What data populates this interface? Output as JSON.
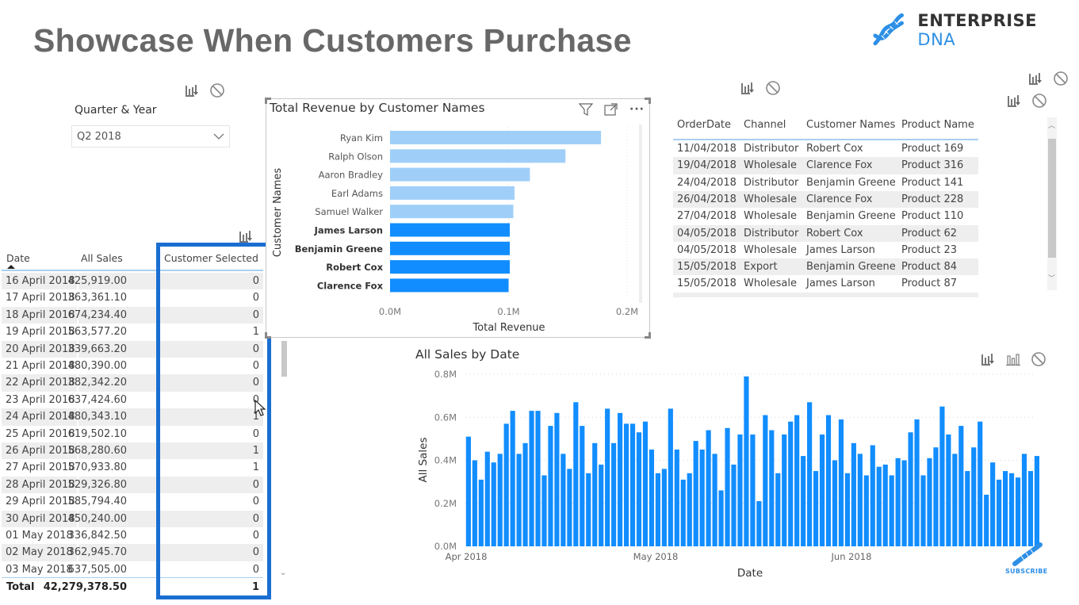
{
  "page": {
    "title": "Showcase When Customers Purchase",
    "logo_text_main": "ENTERPRISE",
    "logo_text_accent": "DNA",
    "subscribe_label": "SUBSCRIBE",
    "accent_color": "#2d8fe6"
  },
  "slicer": {
    "label": "Quarter & Year",
    "selected_value": "Q2 2018"
  },
  "sales_table": {
    "columns": [
      "Date",
      "All Sales",
      "Customer Selected"
    ],
    "rows": [
      {
        "date": "16 April 2018",
        "sales": "425,919.00",
        "selected": "0"
      },
      {
        "date": "17 April 2018",
        "sales": "363,361.10",
        "selected": "0"
      },
      {
        "date": "18 April 2018",
        "sales": "674,234.40",
        "selected": "0"
      },
      {
        "date": "19 April 2018",
        "sales": "563,577.20",
        "selected": "1"
      },
      {
        "date": "20 April 2018",
        "sales": "339,663.20",
        "selected": "0"
      },
      {
        "date": "21 April 2018",
        "sales": "480,390.00",
        "selected": "0"
      },
      {
        "date": "22 April 2018",
        "sales": "382,342.20",
        "selected": "0"
      },
      {
        "date": "23 April 2018",
        "sales": "637,424.60",
        "selected": "0"
      },
      {
        "date": "24 April 2018",
        "sales": "480,343.10",
        "selected": "1"
      },
      {
        "date": "25 April 2018",
        "sales": "619,502.10",
        "selected": "0"
      },
      {
        "date": "26 April 2018",
        "sales": "568,280.60",
        "selected": "1"
      },
      {
        "date": "27 April 2018",
        "sales": "570,933.80",
        "selected": "1"
      },
      {
        "date": "28 April 2018",
        "sales": "529,326.80",
        "selected": "0"
      },
      {
        "date": "29 April 2018",
        "sales": "585,794.40",
        "selected": "0"
      },
      {
        "date": "30 April 2018",
        "sales": "450,240.00",
        "selected": "0"
      },
      {
        "date": "01 May 2018",
        "sales": "336,842.50",
        "selected": "0"
      },
      {
        "date": "02 May 2018",
        "sales": "362,945.70",
        "selected": "0"
      },
      {
        "date": "03 May 2018",
        "sales": "637,505.00",
        "selected": "0"
      }
    ],
    "total": {
      "label": "Total",
      "sales": "42,279,378.50",
      "selected": "1"
    }
  },
  "orders_table": {
    "columns": [
      "OrderDate",
      "Channel",
      "Customer Names",
      "Product Name"
    ],
    "rows": [
      [
        "11/04/2018",
        "Distributor",
        "Robert Cox",
        "Product 169"
      ],
      [
        "19/04/2018",
        "Wholesale",
        "Clarence Fox",
        "Product 316"
      ],
      [
        "24/04/2018",
        "Distributor",
        "Benjamin Greene",
        "Product 141"
      ],
      [
        "26/04/2018",
        "Wholesale",
        "Clarence Fox",
        "Product 228"
      ],
      [
        "27/04/2018",
        "Wholesale",
        "Benjamin Greene",
        "Product 110"
      ],
      [
        "04/05/2018",
        "Distributor",
        "Robert Cox",
        "Product 62"
      ],
      [
        "04/05/2018",
        "Wholesale",
        "James Larson",
        "Product 23"
      ],
      [
        "15/05/2018",
        "Export",
        "Benjamin Greene",
        "Product 84"
      ],
      [
        "15/05/2018",
        "Wholesale",
        "James Larson",
        "Product 87"
      ]
    ]
  },
  "chart_data": [
    {
      "type": "bar",
      "orientation": "horizontal",
      "title": "Total Revenue by Customer Names",
      "xlabel": "Total Revenue",
      "ylabel": "Customer Names",
      "xlim": [
        0,
        0.2
      ],
      "x_ticks": [
        "0.0M",
        "0.1M",
        "0.2M"
      ],
      "grid": true,
      "categories": [
        "Ryan Kim",
        "Ralph Olson",
        "Aaron Bradley",
        "Earl Adams",
        "Samuel Walker",
        "James Larson",
        "Benjamin Greene",
        "Robert Cox",
        "Clarence Fox"
      ],
      "values": [
        0.178,
        0.148,
        0.118,
        0.105,
        0.104,
        0.101,
        0.101,
        0.101,
        0.1
      ],
      "highlighted": [
        false,
        false,
        false,
        false,
        false,
        true,
        true,
        true,
        true
      ],
      "colors": {
        "normal": "#9fcff8",
        "highlight": "#118dff"
      },
      "units": "M"
    },
    {
      "type": "bar",
      "title": "All Sales by Date",
      "xlabel": "Date",
      "ylabel": "All Sales",
      "ylim": [
        0,
        0.8
      ],
      "y_ticks": [
        "0.0M",
        "0.2M",
        "0.4M",
        "0.6M",
        "0.8M"
      ],
      "x_ticks": [
        {
          "label": "Apr 2018",
          "index": 0
        },
        {
          "label": "May 2018",
          "index": 30
        },
        {
          "label": "Jun 2018",
          "index": 61
        }
      ],
      "grid": true,
      "color": "#118dff",
      "units": "M",
      "values": [
        0.51,
        0.4,
        0.31,
        0.44,
        0.39,
        0.43,
        0.57,
        0.63,
        0.43,
        0.48,
        0.63,
        0.63,
        0.33,
        0.56,
        0.62,
        0.43,
        0.36,
        0.67,
        0.56,
        0.34,
        0.48,
        0.38,
        0.64,
        0.48,
        0.62,
        0.57,
        0.57,
        0.53,
        0.58,
        0.45,
        0.34,
        0.36,
        0.64,
        0.45,
        0.31,
        0.34,
        0.49,
        0.45,
        0.54,
        0.43,
        0.26,
        0.55,
        0.38,
        0.52,
        0.79,
        0.52,
        0.21,
        0.61,
        0.54,
        0.34,
        0.52,
        0.58,
        0.61,
        0.42,
        0.67,
        0.35,
        0.52,
        0.61,
        0.4,
        0.59,
        0.34,
        0.48,
        0.43,
        0.33,
        0.47,
        0.37,
        0.38,
        0.33,
        0.41,
        0.4,
        0.53,
        0.59,
        0.33,
        0.41,
        0.46,
        0.65,
        0.52,
        0.43,
        0.56,
        0.35,
        0.46,
        0.58,
        0.24,
        0.39,
        0.31,
        0.35,
        0.34,
        0.32,
        0.43,
        0.35,
        0.42
      ]
    }
  ]
}
